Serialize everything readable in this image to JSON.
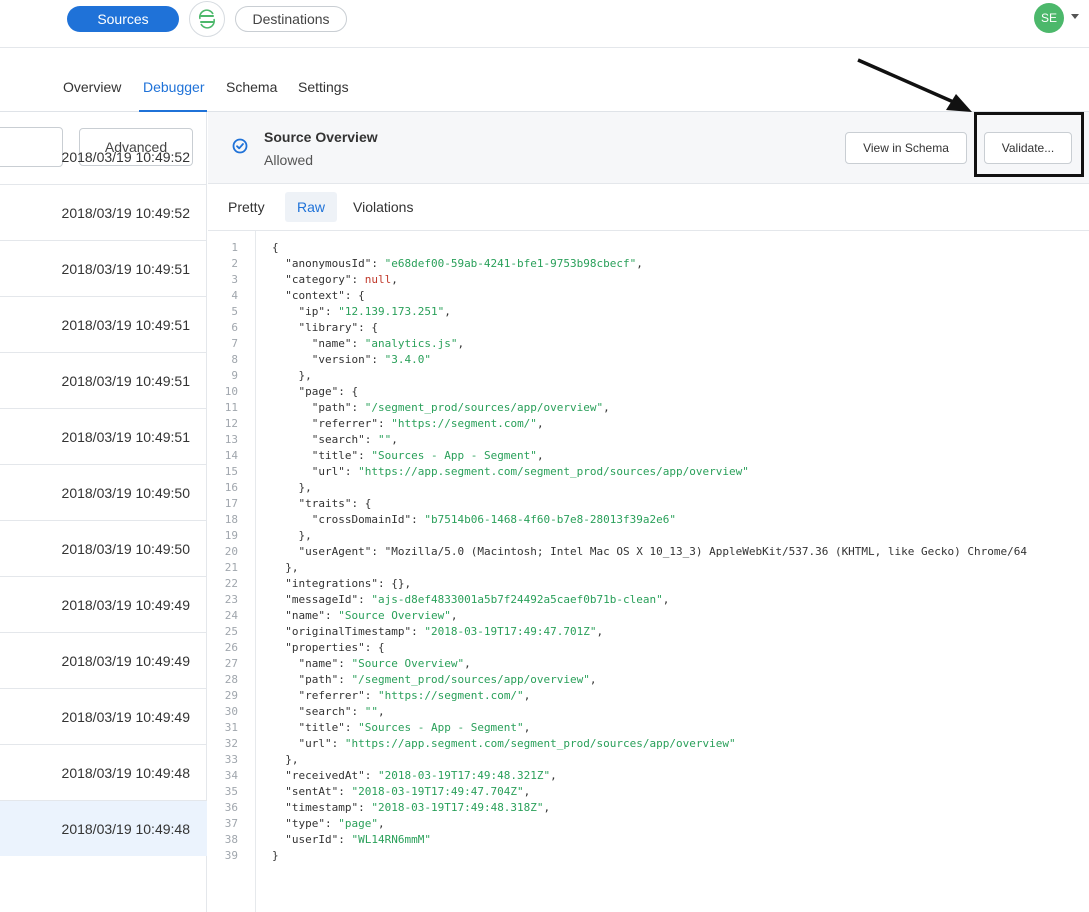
{
  "topbar": {
    "sources_label": "Sources",
    "destinations_label": "Destinations",
    "avatar_initials": "SE"
  },
  "subnav": {
    "tabs": [
      "Overview",
      "Debugger",
      "Schema",
      "Settings"
    ],
    "active": "Debugger"
  },
  "leftpane": {
    "advanced_label": "Advanced",
    "events": [
      "2018/03/19 10:49:52",
      "2018/03/19 10:49:52",
      "2018/03/19 10:49:51",
      "2018/03/19 10:49:51",
      "2018/03/19 10:49:51",
      "2018/03/19 10:49:51",
      "2018/03/19 10:49:50",
      "2018/03/19 10:49:50",
      "2018/03/19 10:49:49",
      "2018/03/19 10:49:49",
      "2018/03/19 10:49:49",
      "2018/03/19 10:49:48",
      "2018/03/19 10:49:48"
    ]
  },
  "detail": {
    "title": "Source Overview",
    "status": "Allowed",
    "view_schema_label": "View in Schema",
    "validate_label": "Validate..."
  },
  "viewtabs": {
    "tabs": [
      "Pretty",
      "Raw",
      "Violations"
    ],
    "active": "Raw"
  },
  "code": [
    "{",
    "  \"anonymousId\": \"e68def00-59ab-4241-bfe1-9753b98cbecf\",",
    "  \"category\": null,",
    "  \"context\": {",
    "    \"ip\": \"12.139.173.251\",",
    "    \"library\": {",
    "      \"name\": \"analytics.js\",",
    "      \"version\": \"3.4.0\"",
    "    },",
    "    \"page\": {",
    "      \"path\": \"/segment_prod/sources/app/overview\",",
    "      \"referrer\": \"https://segment.com/\",",
    "      \"search\": \"\",",
    "      \"title\": \"Sources - App - Segment\",",
    "      \"url\": \"https://app.segment.com/segment_prod/sources/app/overview\"",
    "    },",
    "    \"traits\": {",
    "      \"crossDomainId\": \"b7514b06-1468-4f60-b7e8-28013f39a2e6\"",
    "    },",
    "    \"userAgent\": \"Mozilla/5.0 (Macintosh; Intel Mac OS X 10_13_3) AppleWebKit/537.36 (KHTML, like Gecko) Chrome/64",
    "  },",
    "  \"integrations\": {},",
    "  \"messageId\": \"ajs-d8ef4833001a5b7f24492a5caef0b71b-clean\",",
    "  \"name\": \"Source Overview\",",
    "  \"originalTimestamp\": \"2018-03-19T17:49:47.701Z\",",
    "  \"properties\": {",
    "    \"name\": \"Source Overview\",",
    "    \"path\": \"/segment_prod/sources/app/overview\",",
    "    \"referrer\": \"https://segment.com/\",",
    "    \"search\": \"\",",
    "    \"title\": \"Sources - App - Segment\",",
    "    \"url\": \"https://app.segment.com/segment_prod/sources/app/overview\"",
    "  },",
    "  \"receivedAt\": \"2018-03-19T17:49:48.321Z\",",
    "  \"sentAt\": \"2018-03-19T17:49:47.704Z\",",
    "  \"timestamp\": \"2018-03-19T17:49:48.318Z\",",
    "  \"type\": \"page\",",
    "  \"userId\": \"WL14RN6mmM\"",
    "}"
  ],
  "colors": {
    "accent": "#1f72d8",
    "string": "#2aa05a",
    "null": "#c0392b",
    "avatar": "#4cb86b"
  }
}
